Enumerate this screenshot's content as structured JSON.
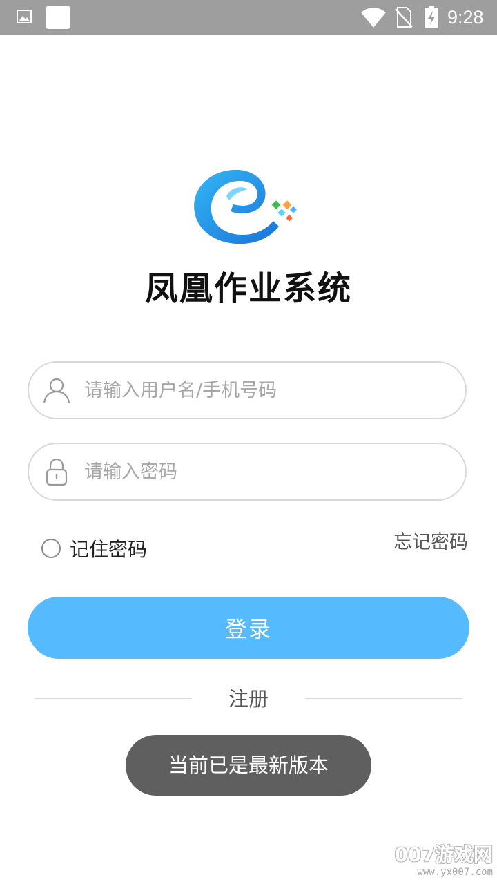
{
  "status_bar": {
    "time": "9:28",
    "icons": [
      "gallery-icon",
      "notification-square-icon",
      "wifi-icon",
      "no-sim-icon",
      "battery-charging-icon"
    ]
  },
  "app": {
    "title": "凤凰作业系统",
    "logo": "app-logo"
  },
  "login_form": {
    "username": {
      "value": "",
      "placeholder": "请输入用户名/手机号码",
      "icon": "user-icon"
    },
    "password": {
      "value": "",
      "placeholder": "请输入密码",
      "icon": "lock-icon"
    },
    "remember_label": "记住密码",
    "remember_checked": false,
    "forgot_label": "忘记密码",
    "login_label": "登录",
    "register_label": "注册"
  },
  "toast": {
    "message": "当前已是最新版本"
  },
  "watermark": {
    "text": "007游戏网",
    "url": "www.yx007.com"
  },
  "colors": {
    "status_bar": "#9e9e9e",
    "accent": "#56baff",
    "toast_bg": "#5f5f5f",
    "input_border": "#d9d9d9"
  }
}
